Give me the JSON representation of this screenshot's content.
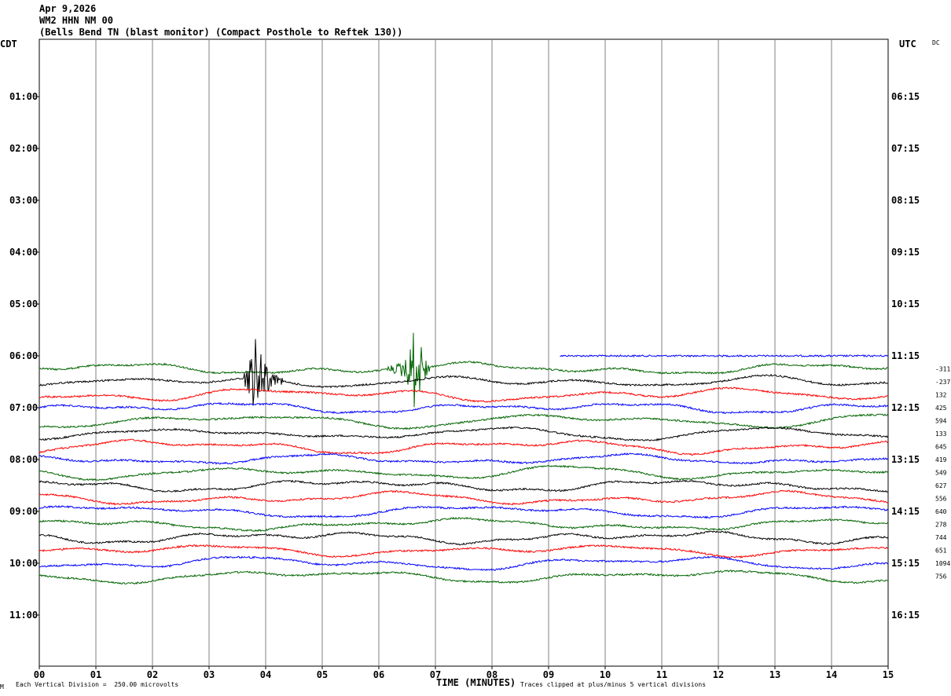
{
  "header": {
    "date": "Apr 9,2026",
    "station": "WM2 HHN NM 00",
    "description": "(Bells Bend TN (blast monitor) (Compact Posthole to Reftek 130))"
  },
  "left_axis_label": "CDT",
  "right_axis_label": "UTC",
  "dc_label": "DC",
  "footer": {
    "scale_note": "Each Vertical Division =  250.00 microvolts",
    "xlabel": "TIME (MINUTES)",
    "clip_note": "Traces clipped at plus/minus 5 vertical divisions",
    "mark": "M"
  },
  "chart_data": {
    "type": "line",
    "title": "Apr 9,2026 WM2 HHN NM 00",
    "xlabel": "TIME (MINUTES)",
    "xlim": [
      0,
      15
    ],
    "x_ticks": [
      "00",
      "01",
      "02",
      "03",
      "04",
      "05",
      "06",
      "07",
      "08",
      "09",
      "10",
      "11",
      "12",
      "13",
      "14",
      "15"
    ],
    "left_time_labels": [
      "01:00",
      "02:00",
      "03:00",
      "04:00",
      "05:00",
      "06:00",
      "07:00",
      "08:00",
      "09:00",
      "10:00",
      "11:00"
    ],
    "right_time_labels": [
      "06:15",
      "07:15",
      "08:15",
      "09:15",
      "10:15",
      "11:15",
      "12:15",
      "13:15",
      "14:15",
      "15:15",
      "16:15"
    ],
    "grid": true,
    "trace_colors": [
      "#000000",
      "#ff0000",
      "#0000ff",
      "#006400"
    ],
    "traces": [
      {
        "row": 24,
        "color": "#0000ff",
        "start_minute": 9.2,
        "dc": ""
      },
      {
        "row": 25,
        "color": "#006400",
        "dc": "-311"
      },
      {
        "row": 26,
        "color": "#000000",
        "dc": "-237"
      },
      {
        "row": 27,
        "color": "#ff0000",
        "dc": "132"
      },
      {
        "row": 28,
        "color": "#0000ff",
        "dc": "425"
      },
      {
        "row": 29,
        "color": "#006400",
        "dc": "594"
      },
      {
        "row": 30,
        "color": "#000000",
        "dc": "133"
      },
      {
        "row": 31,
        "color": "#ff0000",
        "dc": "645"
      },
      {
        "row": 32,
        "color": "#0000ff",
        "dc": "419"
      },
      {
        "row": 33,
        "color": "#006400",
        "dc": "549"
      },
      {
        "row": 34,
        "color": "#000000",
        "dc": "627"
      },
      {
        "row": 35,
        "color": "#ff0000",
        "dc": "556"
      },
      {
        "row": 36,
        "color": "#0000ff",
        "dc": "640"
      },
      {
        "row": 37,
        "color": "#006400",
        "dc": "278"
      },
      {
        "row": 38,
        "color": "#000000",
        "dc": "744"
      },
      {
        "row": 39,
        "color": "#ff0000",
        "dc": "651"
      },
      {
        "row": 40,
        "color": "#0000ff",
        "dc": "1094"
      },
      {
        "row": 41,
        "color": "#006400",
        "dc": "756"
      }
    ],
    "events": [
      {
        "row": 26,
        "start_minute": 3.6,
        "end_minute": 4.3,
        "peak_minute": 3.85
      },
      {
        "row": 25,
        "start_minute": 6.1,
        "end_minute": 6.9,
        "peak_minute": 6.65
      }
    ]
  }
}
